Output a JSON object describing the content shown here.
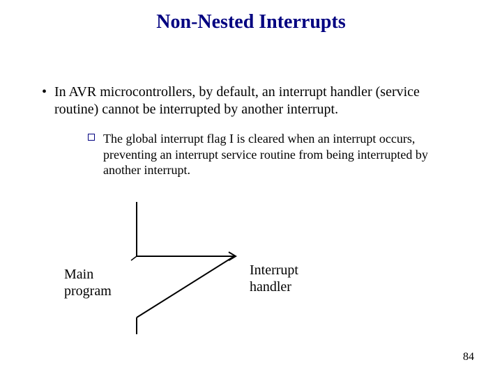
{
  "title": "Non-Nested Interrupts",
  "bullets": {
    "l1": "In AVR microcontrollers, by default, an interrupt handler (service routine) cannot be interrupted by another interrupt.",
    "l2": "The global interrupt flag I is cleared when an interrupt occurs, preventing an interrupt service routine from being interrupted by another interrupt."
  },
  "labels": {
    "left_line1": "Main",
    "left_line2": "program",
    "right_line1": "Interrupt",
    "right_line2": "handler"
  },
  "page_number": "84"
}
